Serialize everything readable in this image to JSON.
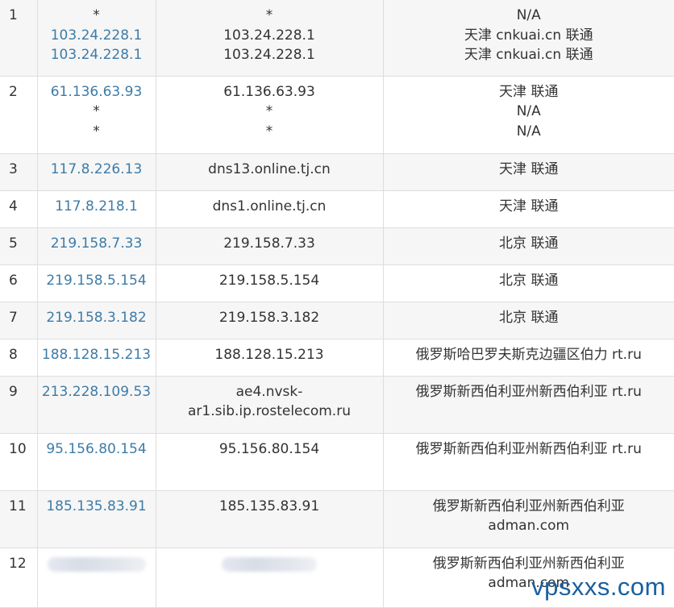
{
  "rows": [
    {
      "hop": "1",
      "ips": [
        "*",
        "103.24.228.1",
        "103.24.228.1"
      ],
      "hosts": [
        "*",
        "103.24.228.1",
        "103.24.228.1"
      ],
      "locations": [
        "N/A",
        "天津 cnkuai.cn 联通",
        "天津 cnkuai.cn 联通"
      ],
      "height": 94,
      "alt": true
    },
    {
      "hop": "2",
      "ips": [
        "61.136.63.93",
        "*",
        "*"
      ],
      "hosts": [
        "61.136.63.93",
        "*",
        "*"
      ],
      "locations": [
        "天津 联通",
        "N/A",
        "N/A"
      ],
      "height": 96,
      "alt": false
    },
    {
      "hop": "3",
      "ips": [
        "117.8.226.13"
      ],
      "hosts": [
        "dns13.online.tj.cn"
      ],
      "locations": [
        "天津 联通"
      ],
      "height": 46,
      "alt": true
    },
    {
      "hop": "4",
      "ips": [
        "117.8.218.1"
      ],
      "hosts": [
        "dns1.online.tj.cn"
      ],
      "locations": [
        "天津 联通"
      ],
      "height": 46,
      "alt": false
    },
    {
      "hop": "5",
      "ips": [
        "219.158.7.33"
      ],
      "hosts": [
        "219.158.7.33"
      ],
      "locations": [
        "北京 联通"
      ],
      "height": 46,
      "alt": true
    },
    {
      "hop": "6",
      "ips": [
        "219.158.5.154"
      ],
      "hosts": [
        "219.158.5.154"
      ],
      "locations": [
        "北京 联通"
      ],
      "height": 46,
      "alt": false
    },
    {
      "hop": "7",
      "ips": [
        "219.158.3.182"
      ],
      "hosts": [
        "219.158.3.182"
      ],
      "locations": [
        "北京 联通"
      ],
      "height": 46,
      "alt": true
    },
    {
      "hop": "8",
      "ips": [
        "188.128.15.213"
      ],
      "hosts": [
        "188.128.15.213"
      ],
      "locations": [
        "俄罗斯哈巴罗夫斯克边疆区伯力 rt.ru"
      ],
      "height": 46,
      "alt": false
    },
    {
      "hop": "9",
      "ips": [
        "213.228.109.53"
      ],
      "hosts": [
        "ae4.nvsk-",
        "ar1.sib.ip.rostelecom.ru"
      ],
      "locations": [
        "俄罗斯新西伯利亚州新西伯利亚 rt.ru"
      ],
      "height": 71,
      "alt": true
    },
    {
      "hop": "10",
      "ips": [
        "95.156.80.154"
      ],
      "hosts": [
        "95.156.80.154"
      ],
      "locations": [
        "俄罗斯新西伯利亚州新西伯利亚 rt.ru"
      ],
      "height": 71,
      "alt": false
    },
    {
      "hop": "11",
      "ips": [
        "185.135.83.91"
      ],
      "hosts": [
        "185.135.83.91"
      ],
      "locations": [
        "俄罗斯新西伯利亚州新西伯利亚",
        "adman.com"
      ],
      "height": 71,
      "alt": true
    },
    {
      "hop": "12",
      "ips": [],
      "hosts": [],
      "locations": [
        "俄罗斯新西伯利亚州新西伯利亚",
        "adman.com"
      ],
      "height": 74,
      "alt": false,
      "blurred": true
    }
  ],
  "watermark": "vpsxxs.com",
  "colors": {
    "link": "#3d7ba8",
    "row_alt": "#f6f6f6",
    "border": "#dedede",
    "watermark": "#1a5f9e"
  }
}
